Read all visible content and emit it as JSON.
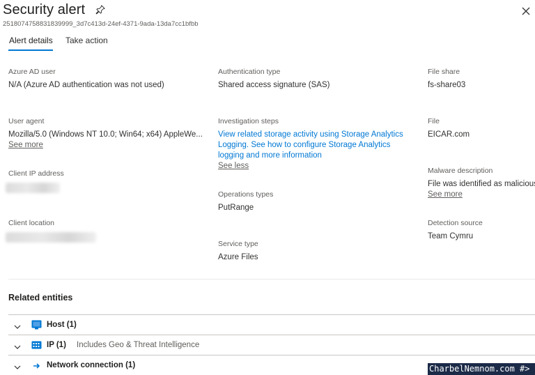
{
  "header": {
    "title": "Security alert",
    "subtitle": "2518074758831839999_3d7c413d-24ef-4371-9ada-13da7cc1bfbb"
  },
  "tabs": [
    {
      "label": "Alert details",
      "active": true
    },
    {
      "label": "Take action",
      "active": false
    }
  ],
  "details": {
    "azure_ad_user": {
      "label": "Azure AD user",
      "value": "N/A (Azure AD authentication was not used)"
    },
    "user_agent": {
      "label": "User agent",
      "value": "Mozilla/5.0 (Windows NT 10.0; Win64; x64) AppleWe...",
      "see_more": "See more"
    },
    "client_ip": {
      "label": "Client IP address"
    },
    "client_location": {
      "label": "Client location"
    },
    "authentication_type": {
      "label": "Authentication type",
      "value": "Shared access signature (SAS)"
    },
    "investigation_steps": {
      "label": "Investigation steps",
      "lines": [
        "View related storage activity using Storage Analytics",
        "Logging. See how to configure Storage Analytics",
        "logging and more information"
      ],
      "see_less": "See less"
    },
    "operations_types": {
      "label": "Operations types",
      "value": "PutRange"
    },
    "service_type": {
      "label": "Service type",
      "value": "Azure Files"
    },
    "file_share": {
      "label": "File share",
      "value": "fs-share03"
    },
    "file": {
      "label": "File",
      "value": "EICAR.com"
    },
    "malware_description": {
      "label": "Malware description",
      "value": "File was identified as malicious,",
      "see_more": "See more"
    },
    "detection_source": {
      "label": "Detection source",
      "value": "Team Cymru"
    }
  },
  "related": {
    "title": "Related entities",
    "rows": [
      {
        "label": "Host (1)",
        "extra": "",
        "icon": "host-icon"
      },
      {
        "label": "IP (1)",
        "extra": "Includes Geo & Threat Intelligence",
        "icon": "ip-icon"
      },
      {
        "label": "Network connection (1)",
        "extra": "",
        "icon": "arrow-right-icon"
      }
    ]
  },
  "watermark": "CharbelNemnom.com #>",
  "colors": {
    "accent": "#0078d4",
    "text": "#323130",
    "muted": "#605e5c"
  }
}
